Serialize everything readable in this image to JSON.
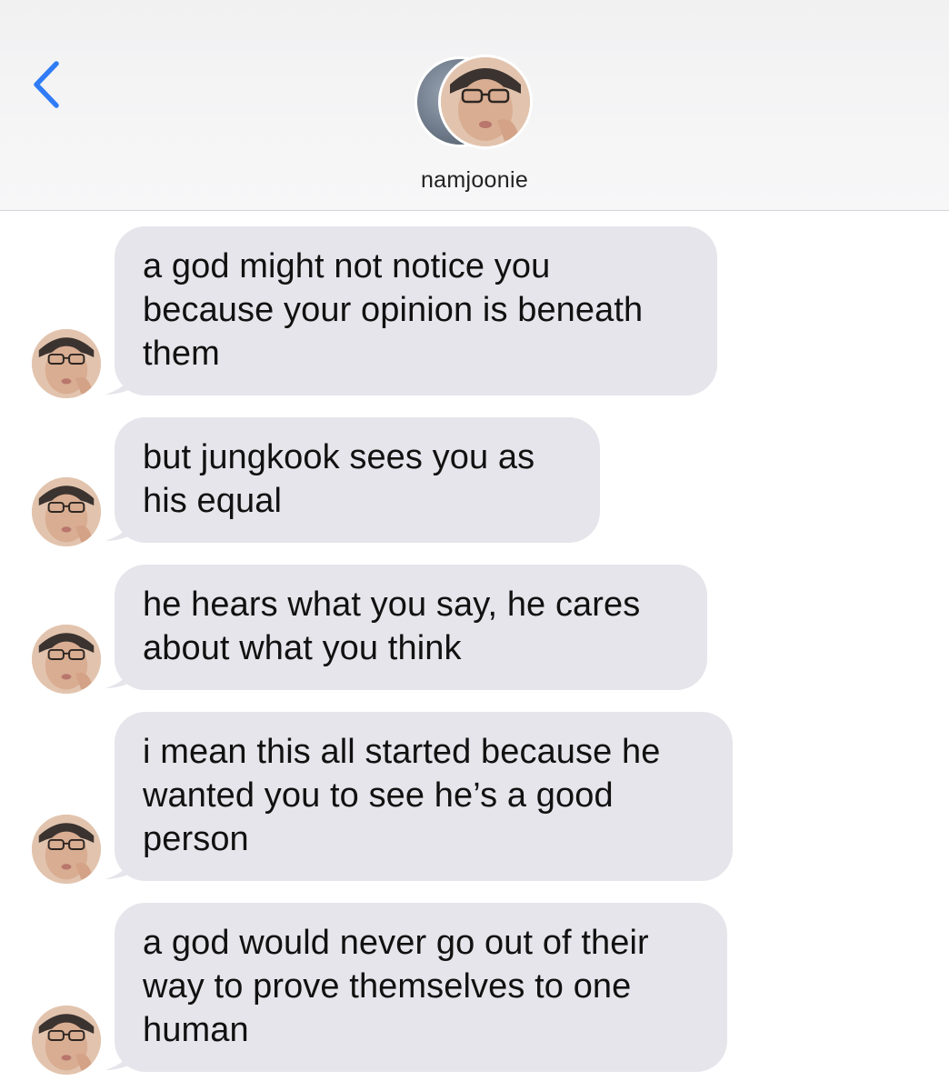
{
  "header": {
    "back_icon": "chevron-left-icon",
    "contact_name": "namjoonie",
    "accent_color": "#2f7cf6"
  },
  "thread": {
    "bubble_color": "#e6e5eb",
    "messages": [
      {
        "lines": [
          "a god might not notice you",
          "because your opinion is beneath",
          "them"
        ]
      },
      {
        "lines": [
          "but jungkook sees you as",
          "his equal"
        ]
      },
      {
        "lines": [
          "he hears what you say, he cares",
          "about what you think"
        ]
      },
      {
        "lines": [
          "i mean this all started because he",
          "wanted you to see he’s a good",
          "person"
        ]
      },
      {
        "lines": [
          "a god would never go out of their",
          "way to prove themselves to one",
          "human"
        ]
      }
    ]
  }
}
